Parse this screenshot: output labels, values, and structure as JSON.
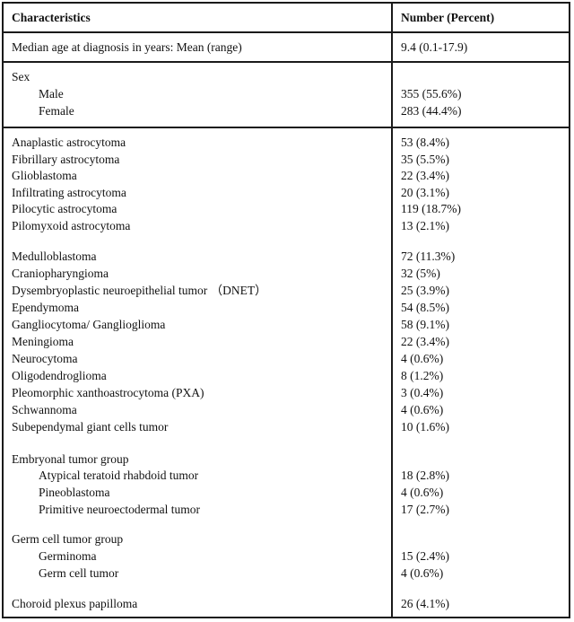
{
  "table": {
    "headers": [
      "Characteristics",
      "Number (Percent)"
    ],
    "age": {
      "label": "Median age at diagnosis in years: Mean (range)",
      "value": "9.4 (0.1-17.9)"
    },
    "sex": {
      "label": "Sex",
      "rows": [
        {
          "label": "Male",
          "value": "355 (55.6%)"
        },
        {
          "label": "Female",
          "value": "283 (44.4%)"
        }
      ]
    },
    "astro_rows": [
      {
        "label": "Anaplastic astrocytoma",
        "value": "53 (8.4%)"
      },
      {
        "label": "Fibrillary astrocytoma",
        "value": "35 (5.5%)"
      },
      {
        "label": "Glioblastoma",
        "value": "22 (3.4%)"
      },
      {
        "label": "Infiltrating astrocytoma",
        "value": "20 (3.1%)"
      },
      {
        "label": "Pilocytic astrocytoma",
        "value": "119 (18.7%)"
      },
      {
        "label": "Pilomyxoid astrocytoma",
        "value": "13 (2.1%)"
      }
    ],
    "other_rows": [
      {
        "label": "Medulloblastoma",
        "value": "72 (11.3%)"
      },
      {
        "label": "Craniopharyngioma",
        "value": "32 (5%)"
      },
      {
        "label": "Dysembryoplastic neuroepithelial tumor （DNET）",
        "value": "25 (3.9%)"
      },
      {
        "label": "Ependymoma",
        "value": "54 (8.5%)"
      },
      {
        "label": "Gangliocytoma/ Ganglioglioma",
        "value": "58 (9.1%)"
      },
      {
        "label": "Meningioma",
        "value": "22 (3.4%)"
      },
      {
        "label": "Neurocytoma",
        "value": "4 (0.6%)"
      },
      {
        "label": "Oligodendroglioma",
        "value": "8 (1.2%)"
      },
      {
        "label": "Pleomorphic xanthoastrocytoma (PXA)",
        "value": "3 (0.4%)"
      },
      {
        "label": "Schwannoma",
        "value": "4 (0.6%)"
      },
      {
        "label": "Subependymal giant cells tumor",
        "value": "10 (1.6%)"
      }
    ],
    "embryonal": {
      "label": "Embryonal tumor group",
      "rows": [
        {
          "label": "Atypical teratoid rhabdoid tumor",
          "value": "18 (2.8%)"
        },
        {
          "label": "Pineoblastoma",
          "value": "4 (0.6%)"
        },
        {
          "label": "Primitive neuroectodermal tumor",
          "value": "17 (2.7%)"
        }
      ]
    },
    "germ": {
      "label": "Germ cell tumor group",
      "rows": [
        {
          "label": "Germinoma",
          "value": "15 (2.4%)"
        },
        {
          "label": "Germ cell tumor",
          "value": "4 (0.6%)"
        }
      ]
    },
    "choroid": {
      "label": "Choroid plexus papilloma",
      "value": "26 (4.1%)"
    }
  }
}
